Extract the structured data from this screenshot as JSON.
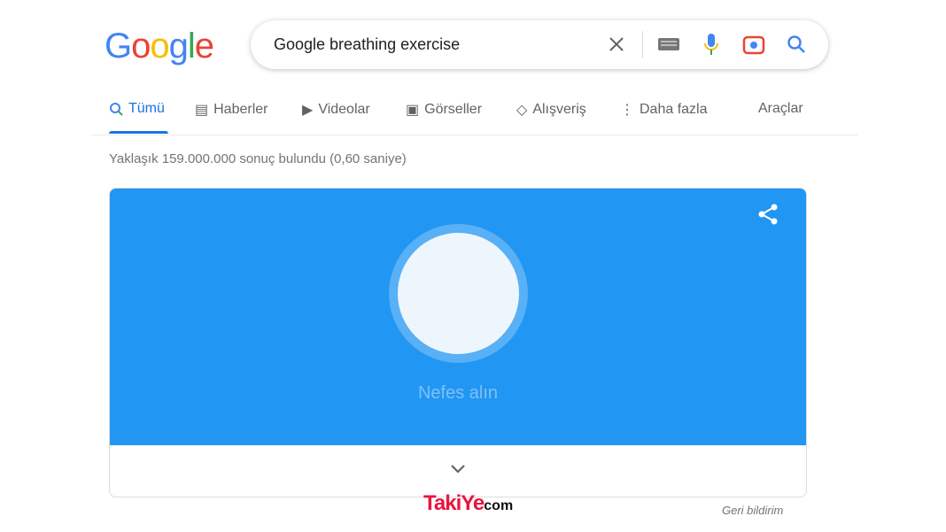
{
  "logo": "Google",
  "search": {
    "query": "Google breathing exercise"
  },
  "tabs": [
    {
      "label": "Tümü",
      "active": true
    },
    {
      "label": "Haberler"
    },
    {
      "label": "Videolar"
    },
    {
      "label": "Görseller"
    },
    {
      "label": "Alışveriş"
    },
    {
      "label": "Daha fazla"
    }
  ],
  "tools_label": "Araçlar",
  "stats": "Yaklaşık 159.000.000 sonuç bulundu (0,60 saniye)",
  "card": {
    "prompt": "Nefes alın",
    "color": "#2196f3"
  },
  "feedback": "Geri bildirim",
  "watermark": {
    "main": "TakiYe",
    "suffix": "com"
  }
}
